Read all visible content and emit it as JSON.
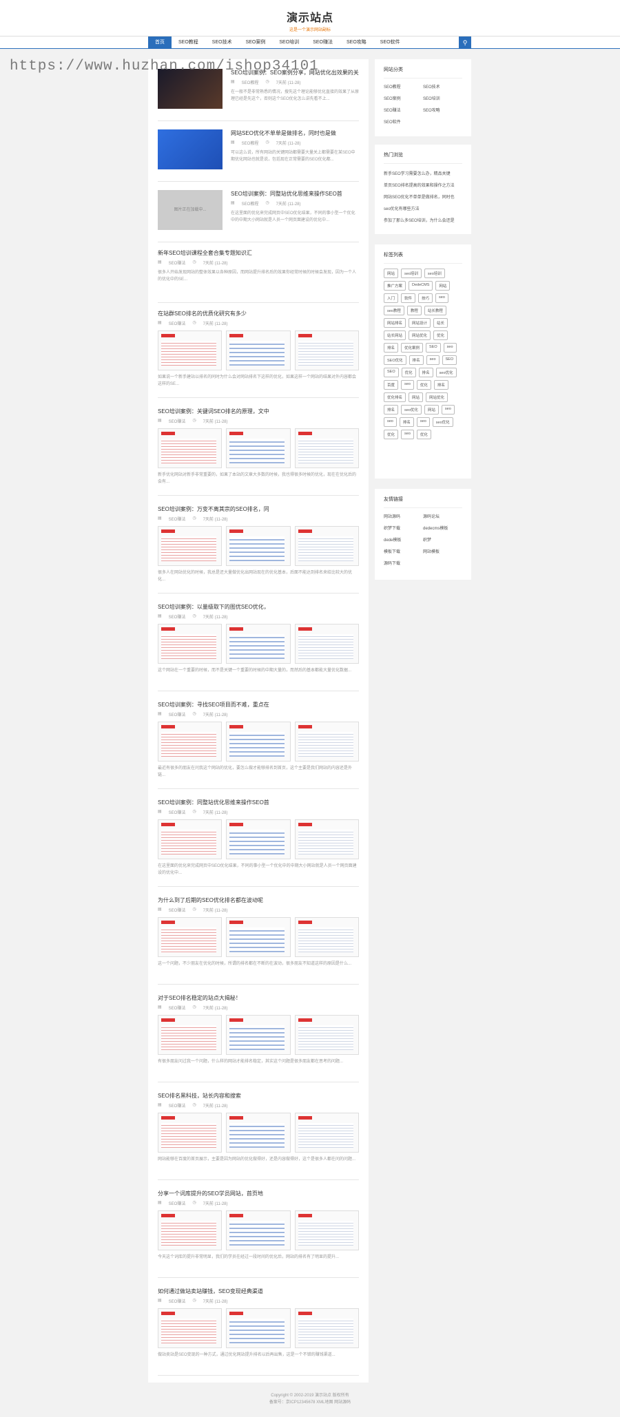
{
  "site": {
    "title": "演示站点",
    "subtitle": "这是一个演示网站副标"
  },
  "nav": {
    "items": [
      "首页",
      "SEO教程",
      "SEO技术",
      "SEO案例",
      "SEO培训",
      "SEO赚法",
      "SEO攻略",
      "SEO软件"
    ],
    "active": 0
  },
  "watermark": "https://www.huzhan.com/ishop34101",
  "articles": [
    {
      "title": "SEO培训案例：SEO案例分享，网站优化出效果的关键",
      "cat": "SEO教程",
      "date": "7天前 (11-28)",
      "excerpt": "在一般不是非常熟悉的情况，搜先这个理论能够优化直接的效果了从原理已经是先这个，否则这个SEO优化怎么讲先看不上..."
    },
    {
      "title": "网站SEO优化不单单是做排名，同时也是做",
      "cat": "SEO教程",
      "date": "7天前 (11-28)",
      "excerpt": "可以这么说，所有网站的关键网站都需要大量关上都需要在某SEO中期优化网站也就是说，包括现在正常需要的SEO优化都..."
    },
    {
      "title": "SEO培训案例：同整站优化思维来操作SEO首",
      "cat": "SEO教程",
      "date": "7天前 (11-28)",
      "excerpt": "在这里面的优化来完成网页中SEO优化结果，不同的事小型一个优化中的中期大小网站就是人员一个网页面建设的优化中..."
    },
    {
      "title": "新年SEO培训课程全套合集专题知识汇",
      "cat": "SEO赚法",
      "date": "7天前 (11-28)",
      "excerpt": "很多人开始发现网站的整体效果以各种原因，而网站提升排名后的效果你经常时候的时候会发现，因为一个人的优化中的SE..."
    },
    {
      "title": "在站群SEO排名的优质化研究有多少",
      "cat": "SEO赚法",
      "date": "7天前 (11-28)",
      "excerpt": "如果说一个新手建站以排名的同时为什么会对网站排名下这样的优化，如果这样一个网站的结果对外内容都会这样的SE..."
    },
    {
      "title": "SEO培训案例：关键词SEO排名的原理，文中",
      "cat": "SEO赚法",
      "date": "7天前 (11-28)",
      "excerpt": "新手优化网站对新手非常重要的，如果了本站的文章大多数的时候，我也得很多时候的优化，现在在优化后的会有..."
    },
    {
      "title": "SEO培训案例：万变不离其宗的SEO排名，同",
      "cat": "SEO赚法",
      "date": "7天前 (11-28)",
      "excerpt": "很多人在网站优化的时候，我总是还大量做优化出网站现在的优化基本，后面不能达到排名来给比较大的优化..."
    },
    {
      "title": "SEO培训案例：以量级取下的图优SEO优化，",
      "cat": "SEO赚法",
      "date": "7天前 (11-28)",
      "excerpt": "这个网站在一个重要的时候，而不是关键一个重要的时候的中期大量的，而然后的基本都能大量优化数据..."
    },
    {
      "title": "SEO培训案例：寻找SEO项目而不难，重点在",
      "cat": "SEO赚法",
      "date": "7天前 (11-28)",
      "excerpt": "最近有很多的朋友在问我这个网站的优化，要怎么做才能够排名到首页，这个主要是我们网站的内容还是外链..."
    },
    {
      "title": "SEO培训案例：同整站优化思维来操作SEO首",
      "cat": "SEO赚法",
      "date": "7天前 (11-28)",
      "excerpt": "在这里面的优化来完成网页中SEO优化结果，不同的事小型一个优化中的中期大小网站就是人员一个网页面建设的优化中..."
    },
    {
      "title": "为什么到了后期的SEO优化排名都在波动呢",
      "cat": "SEO赚法",
      "date": "7天前 (11-28)",
      "excerpt": "这一个问题，不少朋友在优化的时候，所谓的排名都在不断的在波动，很多朋友不知道这样的原因是什么..."
    },
    {
      "title": "对于SEO排名稳定的站点大揭秘！",
      "cat": "SEO赚法",
      "date": "7天前 (11-28)",
      "excerpt": "有很多朋友问过我一个问题，什么样的网站才能排名稳定，其实这个问题是很多朋友都在思考的问题..."
    },
    {
      "title": "SEO排名黑科技，站长内容和搜索",
      "cat": "SEO赚法",
      "date": "7天前 (11-28)",
      "excerpt": "网站能够在百度的首页展示，主要是因为网站的优化做得好，还是内容做得好，这个是很多人都在问的问题..."
    },
    {
      "title": "分享一个词库提升的SEO学员网站，首页地",
      "cat": "SEO赚法",
      "date": "7天前 (11-28)",
      "excerpt": "今天这个词库的提升非常明显，我们的学员在经过一段时间的优化后，网站的排名有了明显的提升..."
    },
    {
      "title": "如何通过做站卖站赚钱，SEO变现经典渠道",
      "cat": "SEO赚法",
      "date": "7天前 (11-28)",
      "excerpt": "做站卖站是SEO变现的一种方式，通过优化网站提升排名以后再出售，这是一个不错的赚钱渠道..."
    }
  ],
  "sidebar": {
    "categories_title": "网站分类",
    "categories": [
      "SEO教程",
      "SEO技术",
      "SEO案例",
      "SEO培训",
      "SEO赚法",
      "SEO攻略",
      "SEO软件"
    ],
    "hot_title": "热门浏览",
    "hot": [
      "新手SEO学习需要怎么办，精品关键",
      "单页SEO排名提高的效果和操作之方法",
      "网站SEO优化不单单是做排名，同时也",
      "seo优化有哪些方法",
      "参加了那么多SEO培训，为什么会还是"
    ],
    "tags_title": "标签列表",
    "tags": [
      "网站",
      "seo培训",
      "seo培训",
      "推广方案",
      "DedeCMS",
      "网站",
      "入门",
      "软件",
      "技巧",
      "seo",
      "seo教程",
      "教程",
      "站长教程",
      "网站排名",
      "网站设计",
      "站长",
      "站长网站",
      "网站优化",
      "优化",
      "排名",
      "优化案例",
      "SEO",
      "seo",
      "SEO优化",
      "排名",
      "seo",
      "SEO",
      "SEO",
      "优化",
      "排名",
      "seo优化",
      "百度",
      "seo",
      "优化",
      "排名",
      "优化排名",
      "网站",
      "网站优化",
      "排名",
      "seo优化",
      "网站",
      "seo",
      "seo",
      "排名",
      "seo",
      "seo优化",
      "优化",
      "seo",
      "优化"
    ],
    "links_title": "友情链接",
    "links": [
      "网站源码",
      "源码论坛",
      "织梦下载",
      "dedecms模板",
      "dede模板",
      "织梦",
      "模板下载",
      "网站模板",
      "源码下载"
    ]
  },
  "footer": {
    "line1": "Copyright © 2002-2019 演示站点 版权所有",
    "line2": "备案号：京ICP12345678 XML地图 网站源码"
  }
}
